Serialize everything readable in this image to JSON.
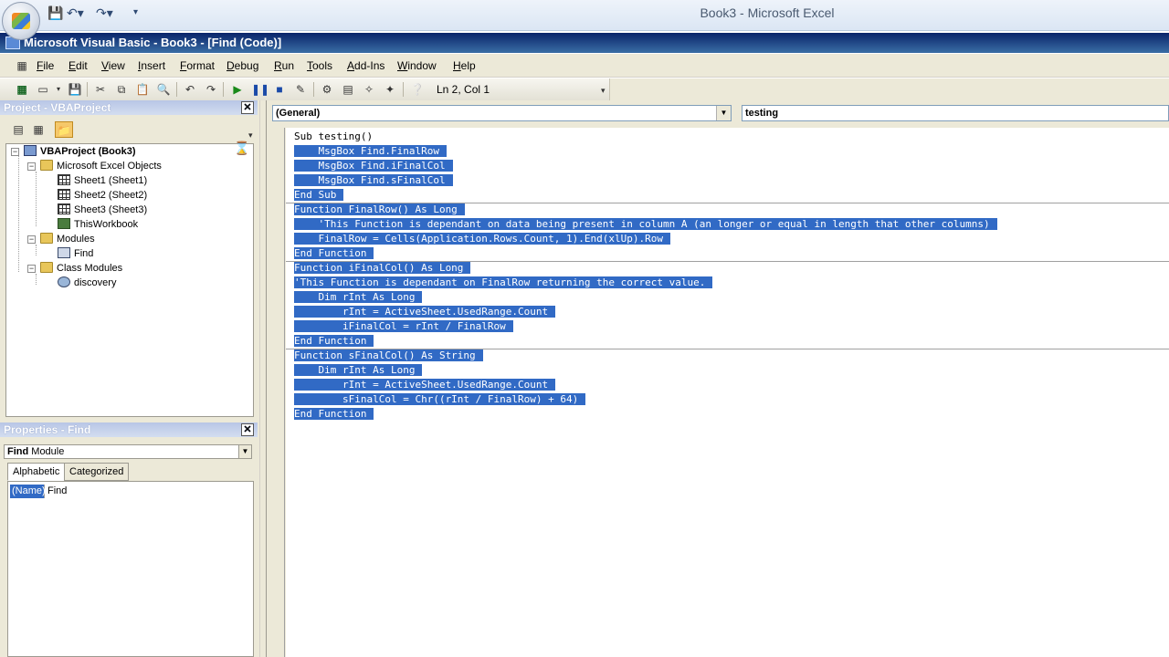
{
  "excel": {
    "title": "Book3 - Microsoft Excel",
    "qat_icons": [
      "save-icon",
      "undo-icon",
      "redo-icon",
      "customize-icon"
    ]
  },
  "vbe": {
    "title": "Microsoft Visual Basic - Book3 - [Find (Code)]"
  },
  "menu": {
    "items": [
      "File",
      "Edit",
      "View",
      "Insert",
      "Format",
      "Debug",
      "Run",
      "Tools",
      "Add-Ins",
      "Window",
      "Help"
    ]
  },
  "toolbar": {
    "position": "Ln 2, Col 1"
  },
  "project_pane": {
    "title": "Project - VBAProject",
    "nodes": [
      {
        "label": "VBAProject (Book3)"
      },
      {
        "label": "Microsoft Excel Objects"
      },
      {
        "label": "Sheet1 (Sheet1)"
      },
      {
        "label": "Sheet2 (Sheet2)"
      },
      {
        "label": "Sheet3 (Sheet3)"
      },
      {
        "label": "ThisWorkbook"
      },
      {
        "label": "Modules"
      },
      {
        "label": "Find"
      },
      {
        "label": "Class Modules"
      },
      {
        "label": "discovery"
      }
    ]
  },
  "properties_pane": {
    "title": "Properties - Find",
    "object_name": "Find",
    "object_type": "Module",
    "tabs": [
      "Alphabetic",
      "Categorized"
    ],
    "property_key": "(Name)",
    "property_value": "Find"
  },
  "code_window": {
    "object_combo": "(General)",
    "procedure_combo": "testing",
    "lines": [
      {
        "text": "Sub testing()",
        "hl": false
      },
      {
        "text": "    MsgBox Find.FinalRow",
        "hl": true
      },
      {
        "text": "    MsgBox Find.iFinalCol",
        "hl": true
      },
      {
        "text": "    MsgBox Find.sFinalCol",
        "hl": true
      },
      {
        "text": "End Sub",
        "hl": true
      },
      {
        "text": "Function FinalRow() As Long",
        "hl": true
      },
      {
        "text": "    'This Function is dependant on data being present in column A (an longer or equal in length that other columns)",
        "hl": true
      },
      {
        "text": "    FinalRow = Cells(Application.Rows.Count, 1).End(xlUp).Row",
        "hl": true
      },
      {
        "text": "End Function",
        "hl": true
      },
      {
        "text": "Function iFinalCol() As Long",
        "hl": true
      },
      {
        "text": "'This Function is dependant on FinalRow returning the correct value.",
        "hl": true
      },
      {
        "text": "    Dim rInt As Long",
        "hl": true
      },
      {
        "text": "        rInt = ActiveSheet.UsedRange.Count",
        "hl": true
      },
      {
        "text": "        iFinalCol = rInt / FinalRow",
        "hl": true
      },
      {
        "text": "End Function",
        "hl": true
      },
      {
        "text": "Function sFinalCol() As String",
        "hl": true
      },
      {
        "text": "    Dim rInt As Long",
        "hl": true
      },
      {
        "text": "        rInt = ActiveSheet.UsedRange.Count",
        "hl": true
      },
      {
        "text": "        sFinalCol = Chr((rInt / FinalRow) + 64)",
        "hl": true
      },
      {
        "text": "End Function",
        "hl": true
      }
    ]
  },
  "colors": {
    "selection": "#316ac5",
    "title_bar": "#0a246a",
    "chrome": "#ece9d8"
  }
}
